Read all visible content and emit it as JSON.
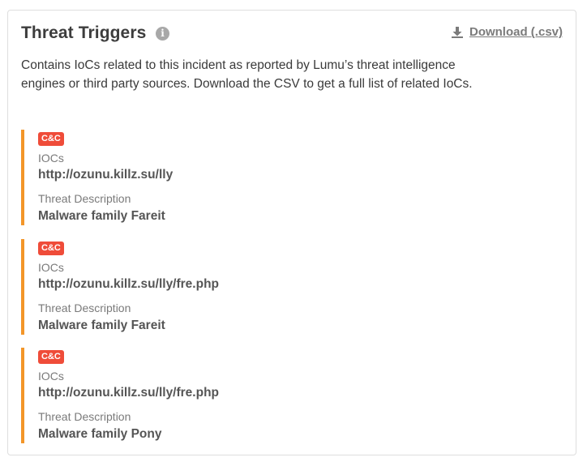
{
  "header": {
    "title": "Threat Triggers",
    "info_icon": "info-circle-icon",
    "info_glyph": "i",
    "download_label": "Download (.csv)",
    "download_icon": "download-icon"
  },
  "description": "Contains IoCs related to this incident as reported by Lumu’s threat intelligence engines or third party sources. Download the CSV to get a full list of related IoCs.",
  "colors": {
    "accent_bar": "#f39629",
    "badge": "#ef4c39"
  },
  "triggers": [
    {
      "badge": "C&C",
      "iocs_label": "IOCs",
      "ioc": "http://ozunu.killz.su/lly",
      "desc_label": "Threat Description",
      "description": "Malware family Fareit"
    },
    {
      "badge": "C&C",
      "iocs_label": "IOCs",
      "ioc": "http://ozunu.killz.su/lly/fre.php",
      "desc_label": "Threat Description",
      "description": "Malware family Fareit"
    },
    {
      "badge": "C&C",
      "iocs_label": "IOCs",
      "ioc": "http://ozunu.killz.su/lly/fre.php",
      "desc_label": "Threat Description",
      "description": "Malware family Pony"
    }
  ]
}
